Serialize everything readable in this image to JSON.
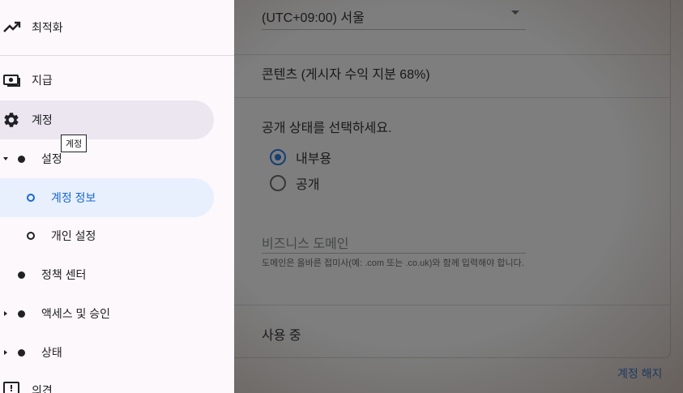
{
  "main": {
    "timezone_value": "(UTC+09:00) 서울",
    "content_share": "콘텐츠 (게시자 수익 지분 68%)",
    "visibility_title": "공개 상태를 선택하세요.",
    "visibility_options": [
      {
        "label": "내부용",
        "selected": true
      },
      {
        "label": "공개",
        "selected": false
      }
    ],
    "business_domain_placeholder": "비즈니스 도메인",
    "business_domain_help": "도메인은 올바른 접미사(예: .com 또는 .co.uk)와 함께 입력해야 합니다.",
    "in_use_label": "사용 중",
    "close_account_link": "계정 해지"
  },
  "sidebar": {
    "items": [
      {
        "label": "최적화",
        "icon": "trending-up-icon"
      },
      {
        "label": "지급",
        "icon": "payments-icon"
      },
      {
        "label": "계정",
        "icon": "gear-icon",
        "active": true
      },
      {
        "label": "설정",
        "icon": "bullet",
        "expandable": true,
        "expanded": true
      },
      {
        "label": "계정 정보",
        "icon": "ring",
        "selected": true
      },
      {
        "label": "개인 설정",
        "icon": "ring"
      },
      {
        "label": "정책 센터",
        "icon": "bullet"
      },
      {
        "label": "액세스 및 승인",
        "icon": "bullet",
        "expandable": true
      },
      {
        "label": "상태",
        "icon": "bullet",
        "expandable": true
      },
      {
        "label": "의견",
        "icon": "feedback-icon"
      }
    ],
    "tooltip": "계정"
  },
  "colors": {
    "accent": "#1a73e8",
    "active_bg": "#ece6f0",
    "selected_bg": "#e8f0fe",
    "drawer_bg": "#fdf8fc"
  }
}
